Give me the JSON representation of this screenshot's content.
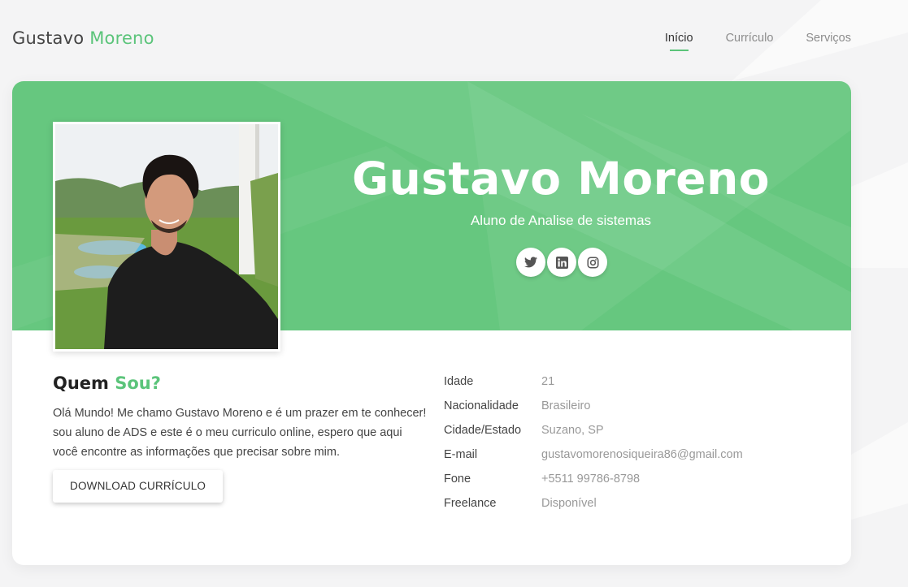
{
  "brand": {
    "first": "Gustavo",
    "last": "Moreno"
  },
  "nav": {
    "items": [
      {
        "label": "Início",
        "active": true
      },
      {
        "label": "Currículo",
        "active": false
      },
      {
        "label": "Serviços",
        "active": false
      }
    ]
  },
  "hero": {
    "name": "Gustavo Moreno",
    "subtitle": "Aluno de Analise de sistemas",
    "socials": [
      "twitter-icon",
      "linkedin-icon",
      "instagram-icon"
    ]
  },
  "about": {
    "title_start": "Quem",
    "title_accent": "Sou?",
    "text": "Olá Mundo! Me chamo Gustavo Moreno e é um prazer em te conhecer! sou aluno de ADS e este é o meu curriculo online, espero que aqui você encontre as informações que precisar sobre mim.",
    "download_label": "Download Currículo"
  },
  "info": [
    {
      "label": "Idade",
      "value": "21"
    },
    {
      "label": "Nacionalidade",
      "value": "Brasileiro"
    },
    {
      "label": "Cidade/Estado",
      "value": "Suzano, SP"
    },
    {
      "label": "E-mail",
      "value": "gustavomorenosiqueira86@gmail.com"
    },
    {
      "label": "Fone",
      "value": "+5511 99786-8798"
    },
    {
      "label": "Freelance",
      "value": "Disponível"
    }
  ],
  "colors": {
    "accent": "#5bc47a",
    "hero_bg": "#66c77f",
    "page_bg": "#f4f4f5"
  }
}
